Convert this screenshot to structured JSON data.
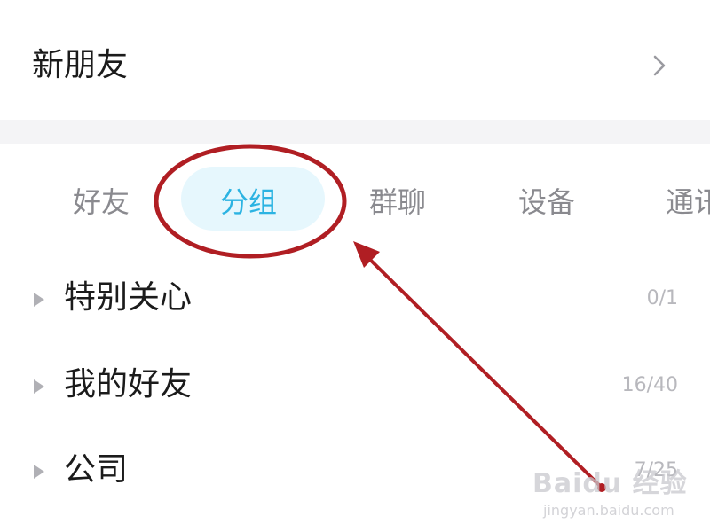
{
  "new_friends": {
    "label": "新朋友",
    "icon": "chevron-right-icon"
  },
  "tabs": [
    {
      "label": "好友",
      "active": false
    },
    {
      "label": "分组",
      "active": true
    },
    {
      "label": "群聊",
      "active": false
    },
    {
      "label": "设备",
      "active": false
    },
    {
      "label": "通讯",
      "active": false
    }
  ],
  "groups": [
    {
      "name": "特别关心",
      "count": "0/1",
      "icon": "caret-right-icon"
    },
    {
      "name": "我的好友",
      "count": "16/40",
      "icon": "caret-right-icon"
    },
    {
      "name": "公司",
      "count": "7/25",
      "icon": "caret-right-icon"
    }
  ],
  "colors": {
    "active_tab_text": "#2bb3e2",
    "active_tab_bg": "#e6f7fd",
    "annotation": "#b01e23",
    "divider": "#f4f4f6"
  },
  "watermark": {
    "logo": "Baidu 经验",
    "url": "jingyan.baidu.com"
  }
}
